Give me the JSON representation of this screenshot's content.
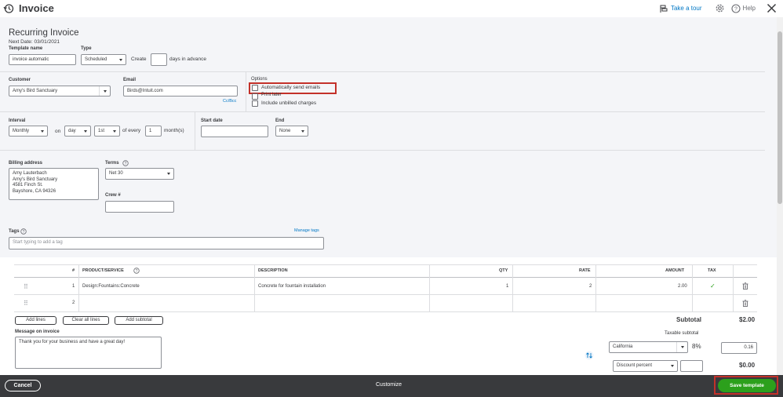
{
  "header": {
    "title": "Invoice",
    "take_tour": "Take a tour",
    "help": "Help"
  },
  "recurring": {
    "heading": "Recurring Invoice",
    "next_date": "Next Date: 03/01/2021",
    "template_name_label": "Template name",
    "template_name_value": "invoice automatic",
    "type_label": "Type",
    "type_value": "Scheduled",
    "create_label": "Create",
    "create_value": "",
    "days_in_advance": "days in advance"
  },
  "customer": {
    "label": "Customer",
    "value": "Amy's Bird Sanctuary",
    "email_label": "Email",
    "email_value": "Birds@Intuit.com",
    "ccbcc": "Cc/Bcc"
  },
  "options": {
    "label": "Options",
    "auto_send": "Automatically send emails",
    "print_later": "Print later",
    "include_unbilled": "Include unbilled charges"
  },
  "interval": {
    "label": "Interval",
    "value": "Monthly",
    "on_label": "on",
    "day_value": "day",
    "day_num_value": "1st",
    "of_every": "of every",
    "months_value": "1",
    "months_label": "month(s)",
    "start_date_label": "Start date",
    "start_date_value": "",
    "end_label": "End",
    "end_value": "None"
  },
  "billing": {
    "label": "Billing address",
    "lines": [
      "Amy Lauterbach",
      "Amy's Bird Sanctuary",
      "4581 Finch St.",
      "Bayshore, CA  94326"
    ],
    "terms_label": "Terms",
    "terms_value": "Net 30",
    "crew_label": "Crew #",
    "crew_value": ""
  },
  "tags": {
    "label": "Tags",
    "manage": "Manage tags",
    "placeholder": "Start typing to add a tag"
  },
  "table": {
    "headers": {
      "num": "#",
      "product": "PRODUCT/SERVICE",
      "description": "DESCRIPTION",
      "qty": "QTY",
      "rate": "RATE",
      "amount": "AMOUNT",
      "tax": "TAX"
    },
    "rows": [
      {
        "num": "1",
        "product": "Design:Fountains:Concrete",
        "description": "Concrete for fountain installation",
        "qty": "1",
        "rate": "2",
        "amount": "2.00",
        "tax": "✓"
      },
      {
        "num": "2",
        "product": "",
        "description": "",
        "qty": "",
        "rate": "",
        "amount": "",
        "tax": ""
      }
    ]
  },
  "buttons": {
    "add_lines": "Add lines",
    "clear_lines": "Clear all lines",
    "add_subtotal": "Add subtotal"
  },
  "message": {
    "label": "Message on invoice",
    "value": "Thank you for your business and have a great day!"
  },
  "totals": {
    "subtotal_label": "Subtotal",
    "subtotal_value": "$2.00",
    "taxable_subtotal": "Taxable subtotal",
    "tax_region": "California",
    "tax_rate": "8%",
    "tax_amount": "0.16",
    "discount_type": "Discount percent",
    "discount_value": "",
    "discount_amount": "$0.00"
  },
  "footer": {
    "cancel": "Cancel",
    "customize": "Customize",
    "save": "Save template"
  }
}
